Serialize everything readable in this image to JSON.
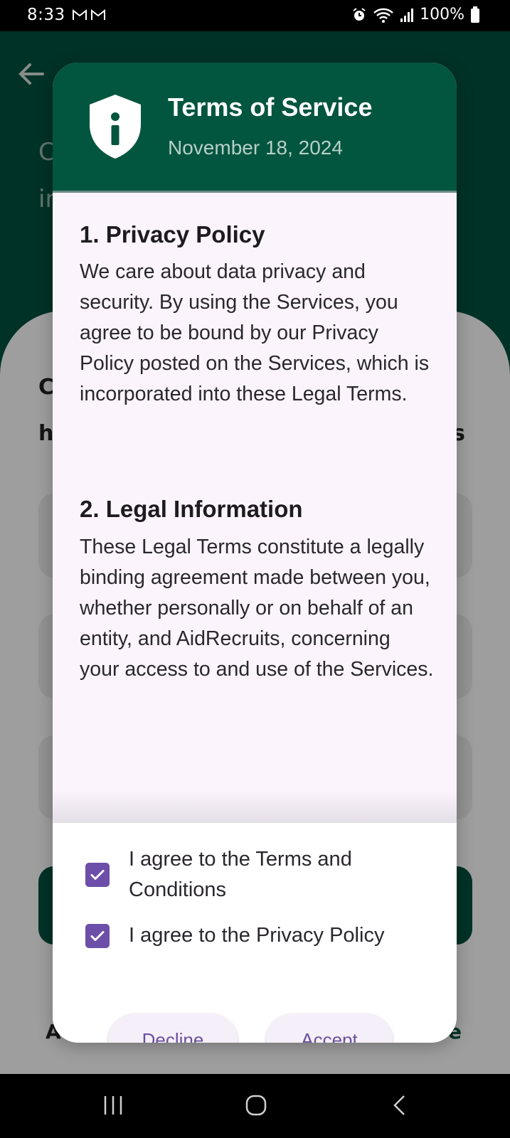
{
  "status_bar": {
    "time": "8:33",
    "battery": "100%",
    "icons": [
      "gmail-icon",
      "gmail-icon",
      "alarm-icon",
      "wifi-icon",
      "signal-icon",
      "battery-icon"
    ]
  },
  "background_app": {
    "header_partial_lines": [
      "C",
      "ir"
    ],
    "sheet_partial_lines": [
      "C",
      "h"
    ],
    "sheet_partial_right": "s",
    "footer_partial_left": "A",
    "footer_partial_right": "e",
    "colors": {
      "header": "#02523f",
      "accent": "#02523f"
    }
  },
  "dialog": {
    "title": "Terms of Service",
    "date": "November 18, 2024",
    "icon": "shield-info-icon",
    "sections": [
      {
        "title": "1. Privacy Policy",
        "text": "We care about data privacy and security. By using the Services, you agree to be bound by our Privacy Policy posted on the Services, which is incorporated into these Legal Terms."
      },
      {
        "title": "2. Legal Information",
        "text": "These Legal Terms constitute a legally binding agreement made between you, whether personally or on behalf of an entity, and AidRecruits, concerning your access to and use of the Services."
      }
    ],
    "checkboxes": [
      {
        "label": "I agree to the Terms and Conditions",
        "checked": true
      },
      {
        "label": "I agree to the Privacy Policy",
        "checked": true
      }
    ],
    "buttons": {
      "decline": "Decline",
      "accept": "Accept"
    },
    "colors": {
      "header": "#02553f",
      "checkbox": "#6d4ea8",
      "button_text": "#6b4f9c",
      "body_bg": "#fbf4fc"
    }
  },
  "nav_bar": {
    "items": [
      "recents-icon",
      "home-icon",
      "back-icon"
    ]
  }
}
